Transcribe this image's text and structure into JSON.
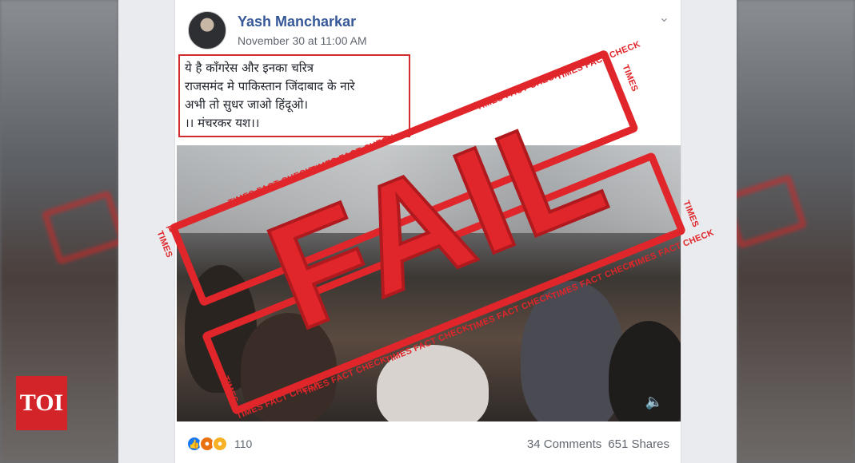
{
  "post": {
    "author": "Yash Mancharkar",
    "timestamp": "November 30 at 11:00 AM",
    "text_lines": [
      "ये है काँगरेस और इनका चरित्र",
      "राजसमंद मे पाकिस्तान जिंदाबाद के नारे",
      "अभी तो सुधर जाओ हिंदूओ।",
      "।। मंचरकर यश।।"
    ]
  },
  "footer": {
    "reaction_count": "110",
    "comments": "34 Comments",
    "shares": "651 Shares"
  },
  "stamps": {
    "verdict": "FAIL",
    "band_label": "TIMES FACT CHECK",
    "corner_label": "TIMES",
    "color": "#e0262a"
  },
  "logo": {
    "text": "TOI",
    "color": "#d3242a"
  },
  "icons": [
    "chevron-down-icon",
    "speaker-icon",
    "like-reaction-icon",
    "angry-reaction-icon",
    "haha-reaction-icon"
  ]
}
